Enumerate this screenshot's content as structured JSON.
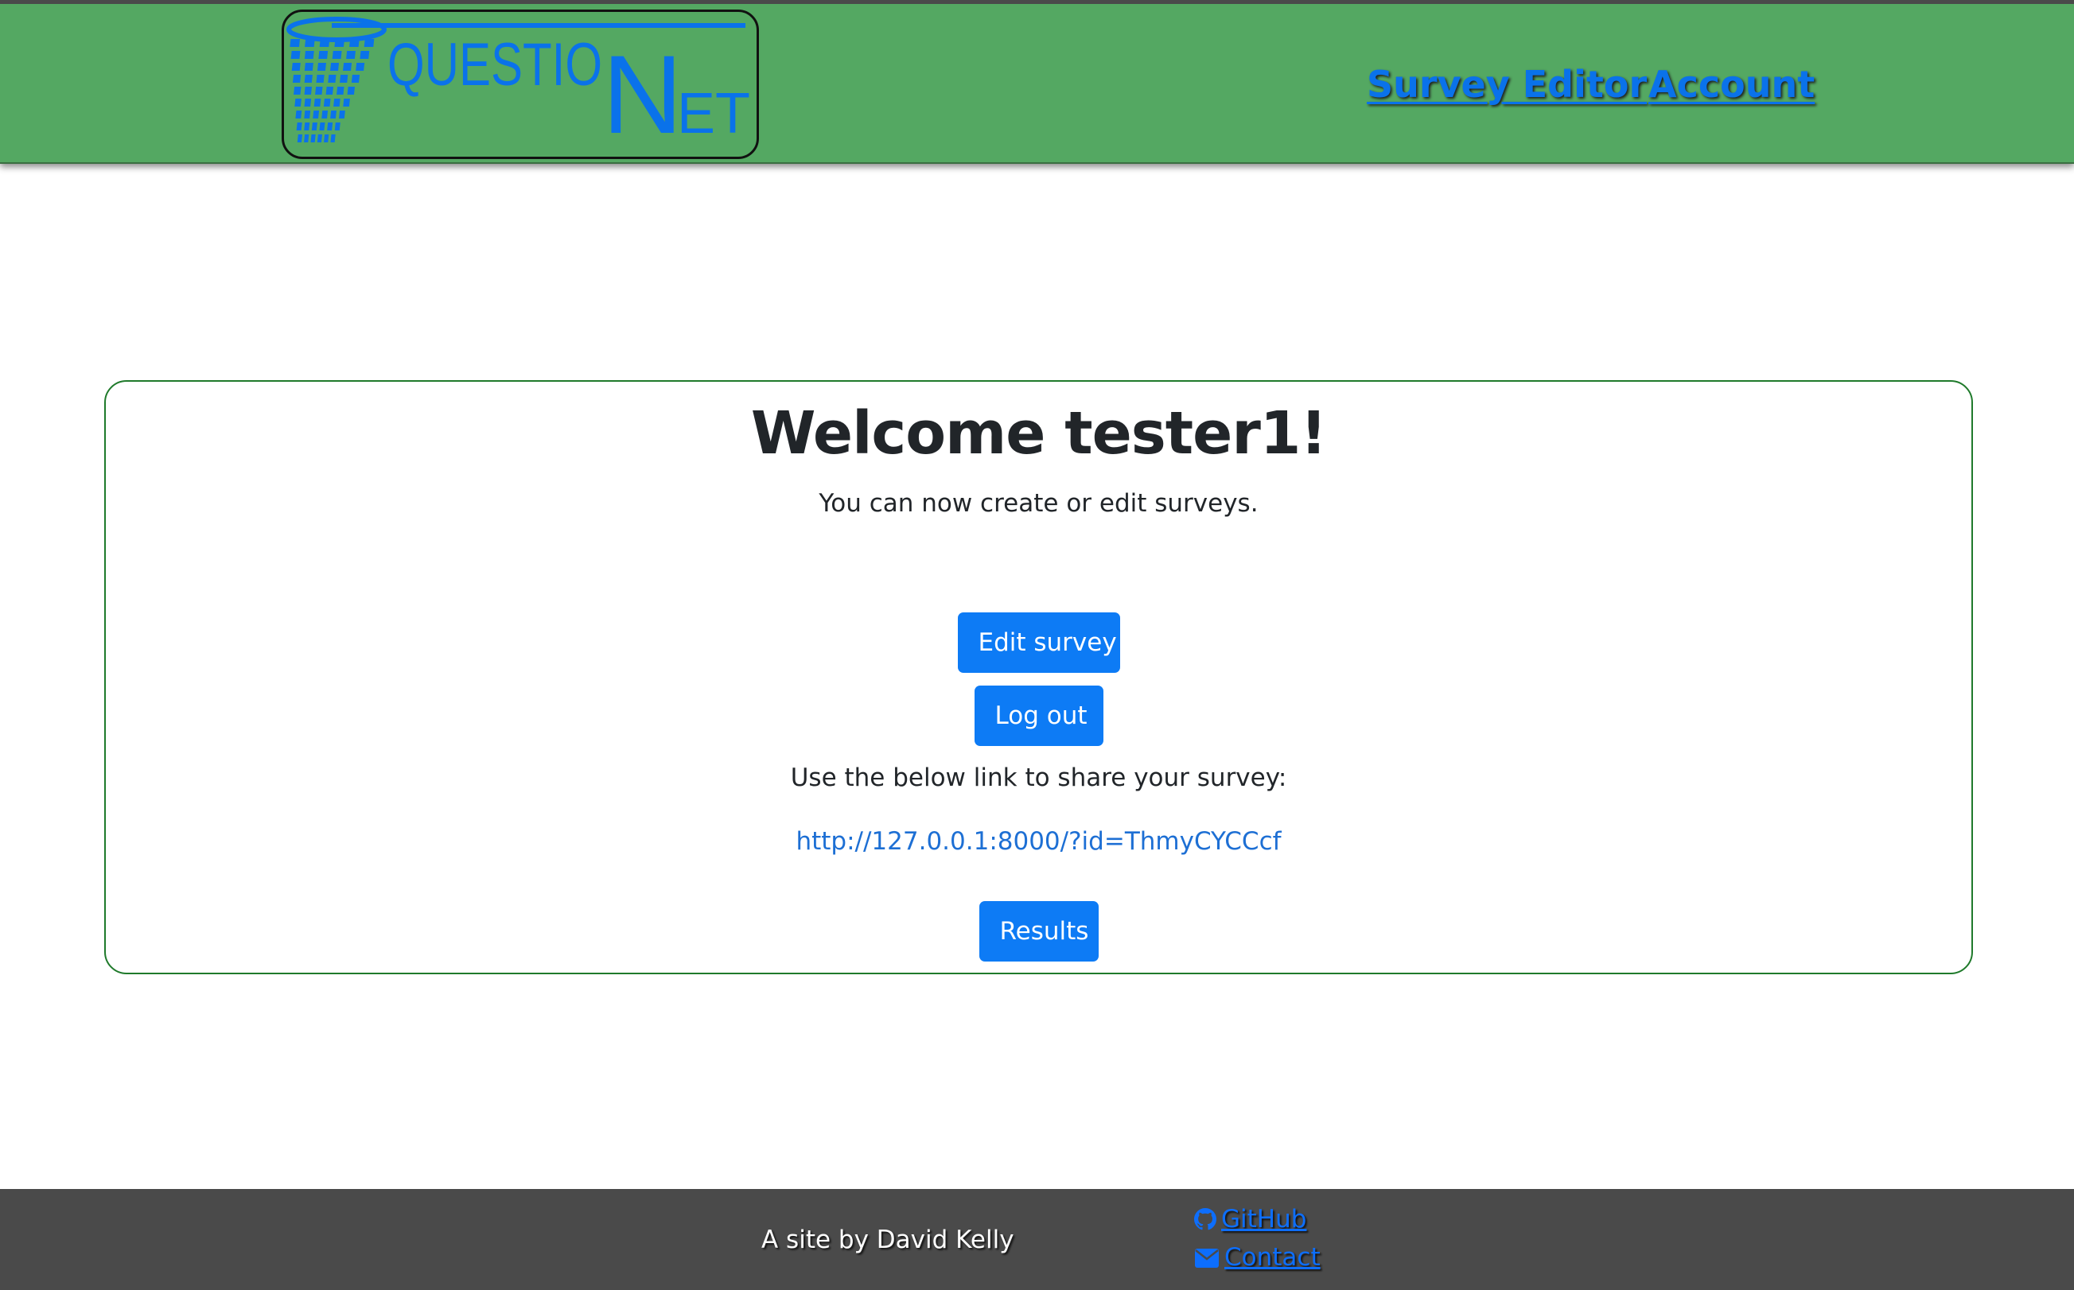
{
  "header": {
    "logo": {
      "text_question": "QUESTIO",
      "text_n": "N",
      "text_et": "ET",
      "icon": "net-icon",
      "color": "#0a72ea",
      "background": "#54a862"
    },
    "nav": [
      {
        "label": "Survey Editor"
      },
      {
        "label": "Account"
      }
    ]
  },
  "main": {
    "title": "Welcome tester1!",
    "subtitle": "You can now create or edit surveys.",
    "edit_button": "Edit survey",
    "logout_button": "Log out",
    "share_text": "Use the below link to share your survey:",
    "share_link": "http://127.0.0.1:8000/?id=ThmyCYCCcf",
    "results_button": "Results"
  },
  "footer": {
    "credit": "A site by David Kelly",
    "links": [
      {
        "label": "GitHub",
        "icon": "github-icon"
      },
      {
        "label": "Contact",
        "icon": "envelope-icon"
      }
    ]
  },
  "colors": {
    "header_bg": "#54a862",
    "footer_bg": "#4a4a4a",
    "primary_button": "#0d7bf5",
    "card_border": "#1f7a2b",
    "link": "#1d6fd4"
  }
}
